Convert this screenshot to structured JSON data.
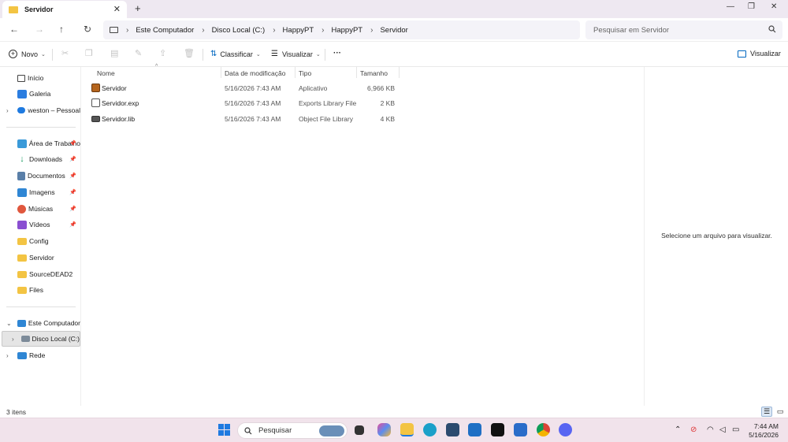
{
  "window": {
    "tab_title": "Servidor",
    "new_tab": "+",
    "controls": {
      "minimize": "—",
      "maximize": "❐",
      "close": "✕"
    }
  },
  "nav": {
    "breadcrumbs": [
      "Este Computador",
      "Disco Local (C:)",
      "HappyPT",
      "HappyPT",
      "Servidor"
    ],
    "search_placeholder": "Pesquisar em Servidor"
  },
  "toolbar": {
    "new_label": "Novo",
    "sort_label": "Classificar",
    "view_label": "Visualizar",
    "more_label": "···",
    "preview_label": "Visualizar"
  },
  "sidebar": {
    "top": [
      {
        "label": "Início",
        "icon": "home-icon"
      },
      {
        "label": "Galeria",
        "icon": "gallery-icon"
      },
      {
        "label": "weston – Pessoal",
        "icon": "onedrive-icon"
      }
    ],
    "quick": [
      {
        "label": "Área de Trabalho",
        "icon": "desktop-icon",
        "pinned": true
      },
      {
        "label": "Downloads",
        "icon": "download-icon",
        "pinned": true
      },
      {
        "label": "Documentos",
        "icon": "documents-icon",
        "pinned": true
      },
      {
        "label": "Imagens",
        "icon": "pictures-icon",
        "pinned": true
      },
      {
        "label": "Músicas",
        "icon": "music-icon",
        "pinned": true
      },
      {
        "label": "Vídeos",
        "icon": "videos-icon",
        "pinned": true
      },
      {
        "label": "Config",
        "icon": "folder-icon",
        "pinned": false
      },
      {
        "label": "Servidor",
        "icon": "folder-icon",
        "pinned": false
      },
      {
        "label": "SourceDEAD2",
        "icon": "folder-icon",
        "pinned": false
      },
      {
        "label": "Files",
        "icon": "folder-icon",
        "pinned": false
      }
    ],
    "devices": [
      {
        "label": "Este Computador",
        "icon": "computer-icon"
      },
      {
        "label": "Disco Local (C:)",
        "icon": "drive-icon"
      },
      {
        "label": "Rede",
        "icon": "network-icon"
      }
    ],
    "pin_glyph": "📌"
  },
  "columns": {
    "name": "Nome",
    "date": "Data de modificação",
    "type": "Tipo",
    "size": "Tamanho"
  },
  "files": [
    {
      "name": "Servidor",
      "date": "5/16/2026 7:43 AM",
      "type": "Aplicativo",
      "size": "6,966 KB",
      "icon": "application-icon"
    },
    {
      "name": "Servidor.exp",
      "date": "5/16/2026 7:43 AM",
      "type": "Exports Library File",
      "size": "2 KB",
      "icon": "exp-file-icon"
    },
    {
      "name": "Servidor.lib",
      "date": "5/16/2026 7:43 AM",
      "type": "Object File Library",
      "size": "4 KB",
      "icon": "lib-file-icon"
    }
  ],
  "preview": {
    "message": "Selecione um arquivo para visualizar."
  },
  "status": {
    "count": "3 itens"
  },
  "taskbar": {
    "search_label": "Pesquisar",
    "time": "7:44 AM",
    "date": "5/16/2026"
  },
  "colors": {
    "accent": "#0067c0",
    "folder": "#f3c443",
    "taskbar_bg": "#f1e3eb",
    "titlebar_bg": "#eee8f1"
  }
}
